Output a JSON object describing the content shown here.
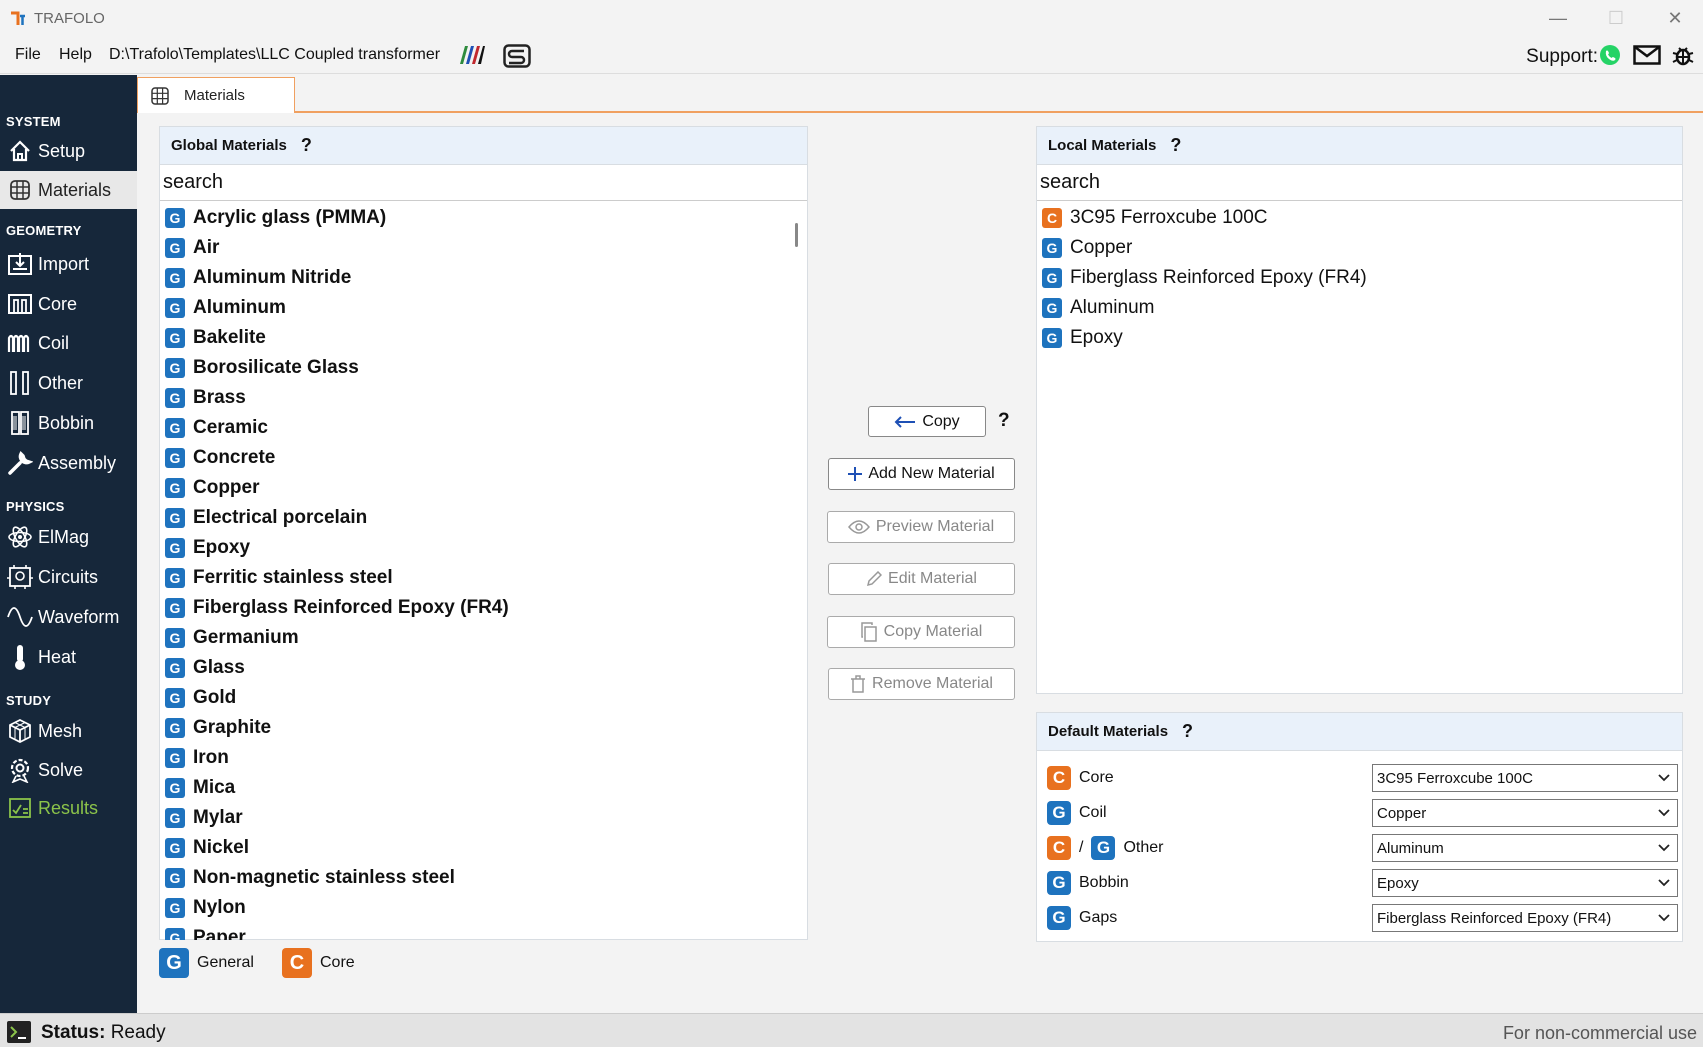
{
  "app": {
    "title": "TRAFOLO"
  },
  "menu": {
    "file": "File",
    "help": "Help",
    "path": "D:\\Trafolo\\Templates\\LLC Coupled transformer",
    "support_label": "Support:"
  },
  "sidebar": {
    "sections": {
      "system": "SYSTEM",
      "geometry": "GEOMETRY",
      "physics": "PHYSICS",
      "study": "STUDY"
    },
    "items": {
      "setup": "Setup",
      "materials": "Materials",
      "import": "Import",
      "core": "Core",
      "coil": "Coil",
      "other": "Other",
      "bobbin": "Bobbin",
      "assembly": "Assembly",
      "elmag": "ElMag",
      "circuits": "Circuits",
      "waveform": "Waveform",
      "heat": "Heat",
      "mesh": "Mesh",
      "solve": "Solve",
      "results": "Results"
    }
  },
  "tab": {
    "label": "Materials"
  },
  "global": {
    "title": "Global Materials",
    "help": "?",
    "search_placeholder": "search",
    "badge": "G",
    "items": [
      "Acrylic glass (PMMA)",
      "Air",
      "Aluminum Nitride",
      "Aluminum",
      "Bakelite",
      "Borosilicate Glass",
      "Brass",
      "Ceramic",
      "Concrete",
      "Copper",
      "Electrical porcelain",
      "Epoxy",
      "Ferritic stainless steel",
      "Fiberglass Reinforced Epoxy (FR4)",
      "Germanium",
      "Glass",
      "Gold",
      "Graphite",
      "Iron",
      "Mica",
      "Mylar",
      "Nickel",
      "Non-magnetic stainless steel",
      "Nylon",
      "Paper"
    ]
  },
  "local": {
    "title": "Local Materials",
    "help": "?",
    "search_placeholder": "search",
    "items": [
      {
        "badge": "C",
        "label": "3C95 Ferroxcube 100C"
      },
      {
        "badge": "G",
        "label": "Copper"
      },
      {
        "badge": "G",
        "label": "Fiberglass Reinforced Epoxy (FR4)"
      },
      {
        "badge": "G",
        "label": "Aluminum"
      },
      {
        "badge": "G",
        "label": "Epoxy"
      }
    ]
  },
  "actions": {
    "copy": "Copy",
    "copy_help": "?",
    "add": "Add New Material",
    "preview": "Preview Material",
    "edit": "Edit Material",
    "copy_material": "Copy Material",
    "remove": "Remove Material"
  },
  "defaults": {
    "title": "Default Materials",
    "help": "?",
    "slash": "/",
    "rows": [
      {
        "badge": "C",
        "label": "Core",
        "value": "3C95 Ferroxcube 100C"
      },
      {
        "badge": "G",
        "label": "Coil",
        "value": "Copper"
      },
      {
        "badge": "G",
        "label": "Other",
        "value": "Aluminum"
      },
      {
        "badge": "G",
        "label": "Bobbin",
        "value": "Epoxy"
      },
      {
        "badge": "G",
        "label": "Gaps",
        "value": "Fiberglass Reinforced Epoxy (FR4)"
      }
    ]
  },
  "legend": {
    "general_badge": "G",
    "general": "General",
    "core_badge": "C",
    "core": "Core"
  },
  "status": {
    "label": "Status:",
    "value": "Ready",
    "right": "For non-commercial use"
  },
  "colors": {
    "general": "#1e73be",
    "core": "#e8711f",
    "sidebar": "#16273a",
    "results": "#8bc34a"
  }
}
